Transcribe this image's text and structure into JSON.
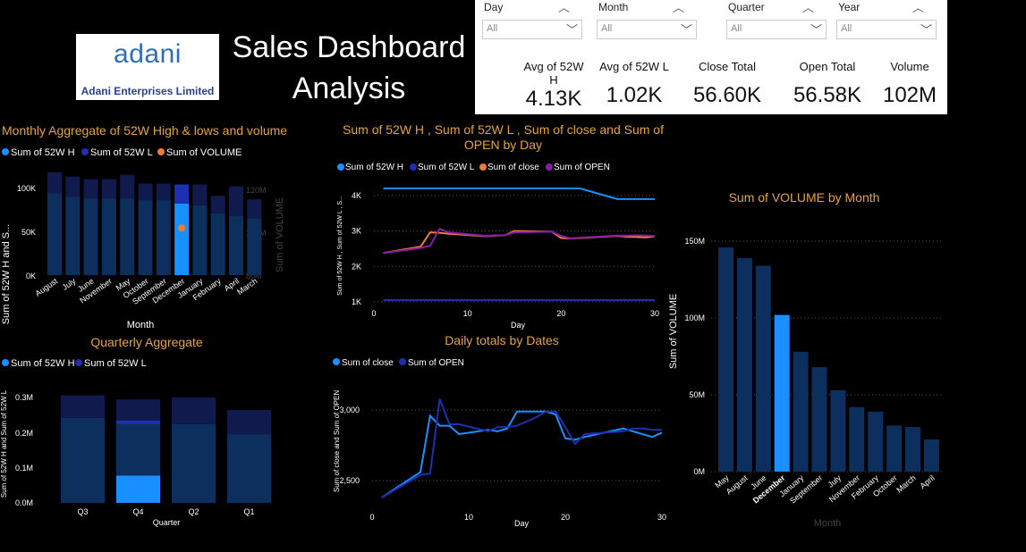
{
  "header": {
    "title_line1": "Sales Dashboard",
    "title_line2": "Analysis",
    "logo_brand": "adani",
    "logo_sub": "Adani Enterprises Limited"
  },
  "slicers": [
    {
      "label": "Day",
      "value": "All"
    },
    {
      "label": "Month",
      "value": "All"
    },
    {
      "label": "Quarter",
      "value": "All"
    },
    {
      "label": "Year",
      "value": "All"
    }
  ],
  "kpis": [
    {
      "label": "Avg of 52W H",
      "value": "4.13K"
    },
    {
      "label": "Avg of 52W L",
      "value": "1.02K"
    },
    {
      "label": "Close Total",
      "value": "56.60K"
    },
    {
      "label": "Open Total",
      "value": "56.58K"
    },
    {
      "label": "Volume",
      "value": "102M"
    }
  ],
  "colors": {
    "accent_title": "#e6a23c",
    "dark_blue": "#0d2f5e",
    "navy": "#101a4d",
    "highlight": "#1a8fff",
    "royal": "#1e2fb0",
    "orange": "#f07a3a",
    "purple": "#8a1ba8"
  },
  "chart_data": [
    {
      "id": "monthly",
      "type": "bar",
      "title": "Monthly Aggregate of 52W High & lows and volume",
      "xlabel": "Month",
      "ylabel": "Sum of 52W H and S...",
      "y2label": "Sum of VOLUME",
      "legend": [
        "Sum of 52W H",
        "Sum of 52W L",
        "Sum of VOLUME"
      ],
      "categories": [
        "August",
        "July",
        "June",
        "November",
        "May",
        "October",
        "September",
        "December",
        "January",
        "February",
        "April",
        "March"
      ],
      "series": [
        {
          "name": "Sum of 52W H",
          "values": [
            94000,
            90000,
            88000,
            88000,
            88000,
            86000,
            86000,
            82000,
            80000,
            71000,
            68000,
            65000
          ]
        },
        {
          "name": "Sum of 52W L",
          "values": [
            24000,
            23000,
            22000,
            22000,
            27000,
            19000,
            19000,
            22000,
            24000,
            20000,
            34000,
            22000
          ]
        }
      ],
      "point": {
        "category": "December",
        "value": 102
      },
      "yticks": [
        "0K",
        "50K",
        "100K"
      ],
      "ylim": [
        0,
        125000
      ],
      "y2ticks": [
        "80M",
        "100M",
        "120M"
      ],
      "highlight": "December"
    },
    {
      "id": "quarterly",
      "type": "bar",
      "title": "Quarterly Aggregate",
      "xlabel": "Quarter",
      "ylabel": "Sum of 52W H and Sum of 52W L",
      "legend": [
        "Sum of 52W H",
        "Sum of 52W L"
      ],
      "categories": [
        "Q3",
        "Q4",
        "Q2",
        "Q1"
      ],
      "series": [
        {
          "name": "Sum of 52W H",
          "values": [
            262000,
            254000,
            243000,
            212000
          ]
        },
        {
          "name": "Sum of 52W L",
          "values": [
            70000,
            65000,
            82000,
            75000
          ]
        }
      ],
      "highlight_segment": {
        "category": "Q4",
        "value": 84000
      },
      "band_segment": {
        "category": "Q4",
        "value": 24000
      },
      "yticks": [
        "0.0M",
        "0.1M",
        "0.2M",
        "0.3M"
      ],
      "ylim": [
        0,
        350000
      ]
    },
    {
      "id": "daily4",
      "type": "line",
      "title": "Sum of 52W H , Sum of 52W L , Sum of close and Sum of OPEN by Day",
      "xlabel": "Day",
      "ylabel": "Sum of 52W H , Sum of 52W L , S...",
      "legend": [
        "Sum of 52W H",
        "Sum of 52W L",
        "Sum of close",
        "Sum of OPEN"
      ],
      "x": [
        1,
        5,
        6,
        7,
        8,
        12,
        13,
        14,
        15,
        19,
        20,
        21,
        22,
        26,
        27,
        28,
        29,
        30
      ],
      "series": [
        {
          "name": "Sum of 52W H",
          "values": [
            4200,
            4200,
            4200,
            4200,
            4200,
            4200,
            4200,
            4200,
            4200,
            4200,
            4200,
            4200,
            4200,
            3900,
            3900,
            3900,
            3900,
            3900
          ]
        },
        {
          "name": "Sum of 52W L",
          "values": [
            1050,
            1050,
            1050,
            1050,
            1050,
            1050,
            1050,
            1050,
            1050,
            1050,
            1050,
            1050,
            1050,
            1050,
            1050,
            1050,
            1050,
            1050
          ]
        },
        {
          "name": "Sum of close",
          "values": [
            2380,
            2560,
            2960,
            2950,
            2920,
            2850,
            2870,
            2880,
            3000,
            2980,
            2800,
            2790,
            2800,
            2860,
            2840,
            2830,
            2820,
            2850
          ]
        },
        {
          "name": "Sum of OPEN",
          "values": [
            2380,
            2520,
            2580,
            3060,
            2960,
            2860,
            2880,
            2880,
            2960,
            2980,
            2860,
            2790,
            2810,
            2870,
            2870,
            2880,
            2870,
            2860
          ]
        }
      ],
      "xticks": [
        0,
        10,
        20,
        30
      ],
      "yticks": [
        "1K",
        "2K",
        "3K",
        "4K"
      ],
      "ylim": [
        950,
        4450
      ],
      "xlim": [
        0,
        30
      ]
    },
    {
      "id": "dailytotals",
      "type": "line",
      "title": "Daily totals by Dates",
      "xlabel": "Day",
      "ylabel": "Sum of close and Sum of OPEN",
      "legend": [
        "Sum of close",
        "Sum of OPEN"
      ],
      "x": [
        1,
        5,
        6,
        7,
        8,
        9,
        12,
        13,
        14,
        15,
        17,
        18,
        19,
        20,
        21,
        22,
        26,
        27,
        28,
        29,
        30
      ],
      "series": [
        {
          "name": "Sum of close",
          "values": [
            2380,
            2560,
            2960,
            2890,
            2890,
            2830,
            2860,
            2850,
            2870,
            2990,
            2990,
            2990,
            2970,
            2800,
            2790,
            2810,
            2870,
            2850,
            2830,
            2810,
            2840
          ]
        },
        {
          "name": "Sum of OPEN",
          "values": [
            2380,
            2540,
            2550,
            3080,
            2900,
            2900,
            2850,
            2880,
            2880,
            2890,
            2950,
            2990,
            2990,
            2880,
            2760,
            2830,
            2850,
            2870,
            2870,
            2860,
            2860
          ]
        }
      ],
      "xticks": [
        0,
        10,
        20,
        30
      ],
      "yticks": [
        "2,500",
        "3,000"
      ],
      "ylim": [
        2310,
        3160
      ],
      "xlim": [
        0,
        30
      ]
    },
    {
      "id": "volume",
      "type": "bar",
      "title": "Sum of VOLUME by Month",
      "xlabel": "Month",
      "ylabel": "Sum of VOLUME",
      "categories": [
        "May",
        "August",
        "June",
        "December",
        "January",
        "September",
        "July",
        "November",
        "February",
        "October",
        "March",
        "April"
      ],
      "values": [
        146,
        139,
        134,
        102,
        78,
        68,
        53,
        42,
        39,
        30,
        29,
        21
      ],
      "yticks": [
        "0M",
        "50M",
        "100M",
        "150M"
      ],
      "ylim": [
        0,
        157
      ],
      "highlight": "December"
    }
  ]
}
